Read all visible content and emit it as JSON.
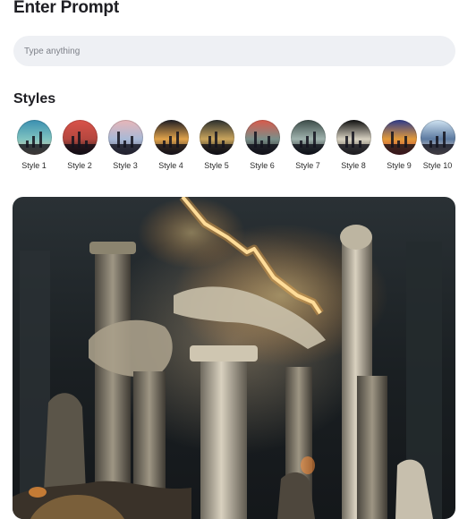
{
  "header": {
    "title": "Enter Prompt"
  },
  "prompt": {
    "placeholder": "Type anything",
    "value": ""
  },
  "styles": {
    "heading": "Styles",
    "items": [
      {
        "label": "Style 1",
        "colors": [
          "#3a8fb0",
          "#7fc3c0",
          "#d8c29a"
        ]
      },
      {
        "label": "Style 2",
        "colors": [
          "#d9534a",
          "#b5473f",
          "#2a1c1c"
        ]
      },
      {
        "label": "Style 3",
        "colors": [
          "#e8b6b8",
          "#a8b9d6",
          "#6f6a7e"
        ]
      },
      {
        "label": "Style 4",
        "colors": [
          "#1c1c24",
          "#e0a24a",
          "#3a2f2c"
        ]
      },
      {
        "label": "Style 5",
        "colors": [
          "#2a2e2d",
          "#c9a45c",
          "#1a1a18"
        ]
      },
      {
        "label": "Style 6",
        "colors": [
          "#d95a4b",
          "#7a8f8a",
          "#2a2626"
        ]
      },
      {
        "label": "Style 7",
        "colors": [
          "#3b4b48",
          "#9fb2ad",
          "#1e2524"
        ]
      },
      {
        "label": "Style 8",
        "colors": [
          "#0e0e0e",
          "#d6d0c0",
          "#5a5446"
        ]
      },
      {
        "label": "Style 9",
        "colors": [
          "#2d3a8a",
          "#e39a3a",
          "#c63f3a"
        ]
      },
      {
        "label": "Style 10",
        "colors": [
          "#cfe3f2",
          "#5c7aa0",
          "#e8d6cf"
        ]
      }
    ]
  },
  "generated_image": {
    "alt": ""
  }
}
